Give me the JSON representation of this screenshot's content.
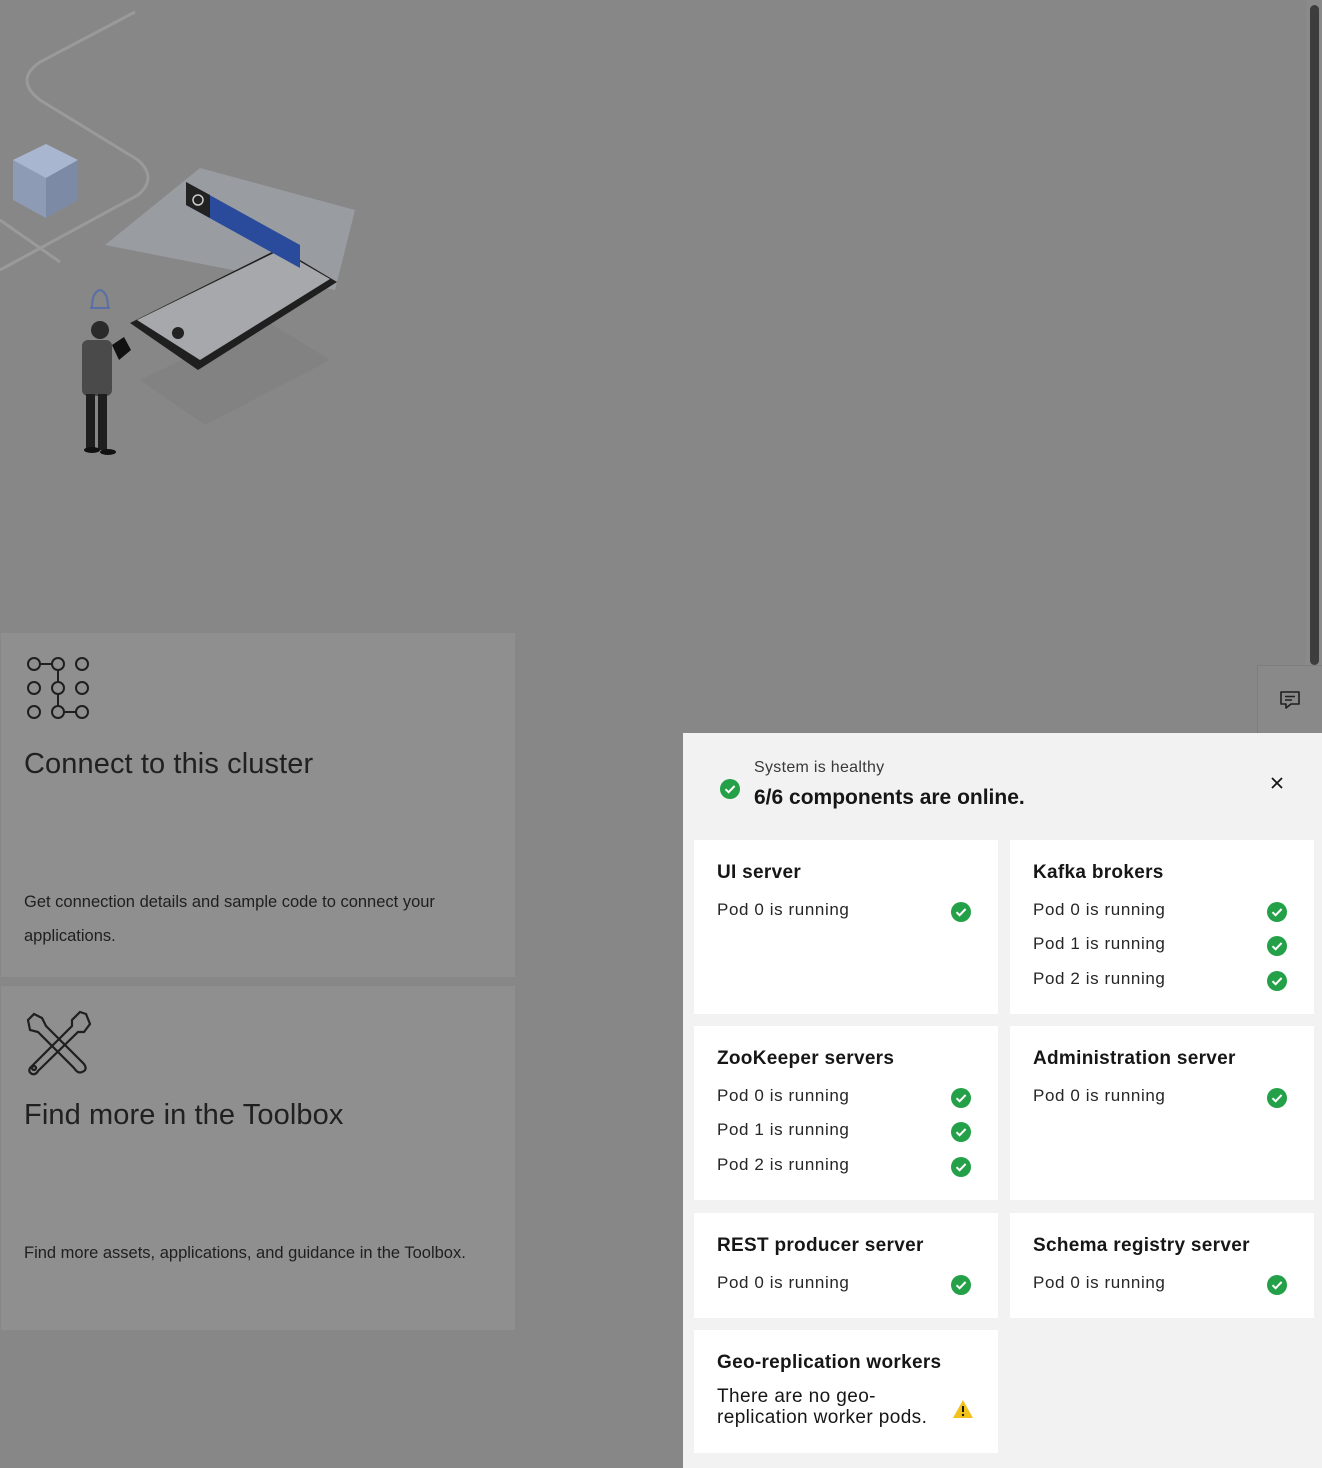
{
  "tiles": {
    "connect": {
      "title": "Connect to this cluster",
      "description": "Get connection details and sample code to connect your applications.",
      "icon": "connection-icon"
    },
    "toolbox": {
      "title": "Find more in the Toolbox",
      "description": "Find more assets, applications, and guidance in the Toolbox.",
      "icon": "tools-icon"
    }
  },
  "feedback": {
    "icon": "chat-icon"
  },
  "status_panel": {
    "subtitle": "System is healthy",
    "title": "6/6 components are online.",
    "close_icon": "close-icon",
    "colors": {
      "success": "#24a148",
      "warning": "#f1c21b",
      "panel_bg": "#f2f2f2"
    },
    "components": [
      {
        "name": "UI server",
        "pods": [
          "Pod 0 is running"
        ]
      },
      {
        "name": "Kafka brokers",
        "pods": [
          "Pod 0 is running",
          "Pod 1 is running",
          "Pod 2 is running"
        ]
      },
      {
        "name": "ZooKeeper servers",
        "pods": [
          "Pod 0 is running",
          "Pod 1 is running",
          "Pod 2 is running"
        ]
      },
      {
        "name": "Administration server",
        "pods": [
          "Pod 0 is running"
        ]
      },
      {
        "name": "REST producer server",
        "pods": [
          "Pod 0 is running"
        ]
      },
      {
        "name": "Schema registry server",
        "pods": [
          "Pod 0 is running"
        ]
      },
      {
        "name": "Geo-replication workers",
        "warning": "There are no geo-replication worker pods."
      }
    ]
  }
}
